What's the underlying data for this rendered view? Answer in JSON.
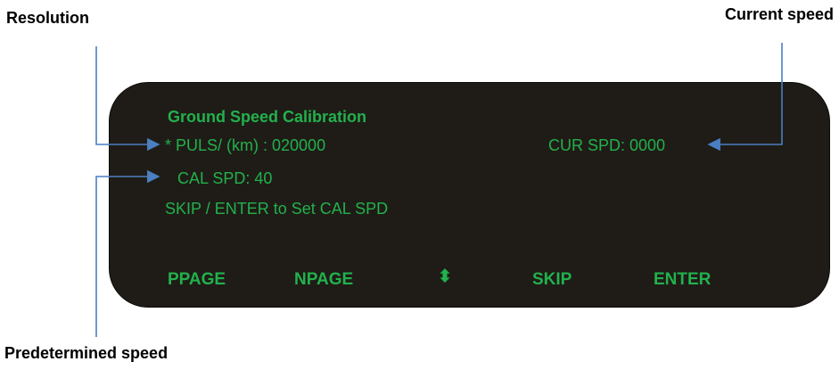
{
  "callouts": {
    "resolution": "Resolution",
    "current_speed": "Current speed",
    "predetermined_speed": "Predetermined speed"
  },
  "screen": {
    "title": "Ground Speed Calibration",
    "puls_row": "* PULS/ (km) : 020000",
    "cur_spd": "CUR SPD: 0000",
    "cal_spd": "CAL SPD: 40",
    "hint": "SKIP / ENTER to Set CAL SPD",
    "softkeys": {
      "ppage": "PPAGE",
      "npage": "NPAGE",
      "updown": "⬍",
      "skip": "SKIP",
      "enter": "ENTER"
    }
  },
  "colors": {
    "screen_bg": "#1f1c17",
    "screen_text": "#22b14c",
    "arrow": "#4a7fc1",
    "label": "#000000"
  }
}
